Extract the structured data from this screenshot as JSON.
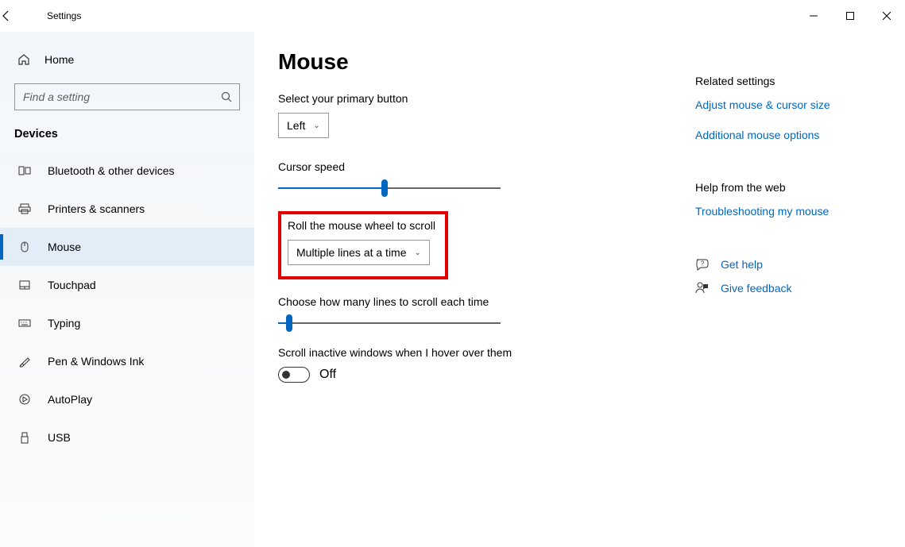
{
  "window": {
    "title": "Settings"
  },
  "sidebar": {
    "home": "Home",
    "search_placeholder": "Find a setting",
    "section_label": "Devices",
    "items": [
      {
        "label": "Bluetooth & other devices"
      },
      {
        "label": "Printers & scanners"
      },
      {
        "label": "Mouse"
      },
      {
        "label": "Touchpad"
      },
      {
        "label": "Typing"
      },
      {
        "label": "Pen & Windows Ink"
      },
      {
        "label": "AutoPlay"
      },
      {
        "label": "USB"
      }
    ]
  },
  "page": {
    "title": "Mouse",
    "primary_button_label": "Select your primary button",
    "primary_button_value": "Left",
    "cursor_speed_label": "Cursor speed",
    "cursor_speed_percent": 48,
    "scroll_mode_label": "Roll the mouse wheel to scroll",
    "scroll_mode_value": "Multiple lines at a time",
    "lines_label": "Choose how many lines to scroll each time",
    "lines_percent": 5,
    "inactive_label": "Scroll inactive windows when I hover over them",
    "inactive_state_text": "Off"
  },
  "right": {
    "related_head": "Related settings",
    "link_adjust": "Adjust mouse & cursor size",
    "link_additional": "Additional mouse options",
    "help_head": "Help from the web",
    "link_trouble": "Troubleshooting my mouse",
    "get_help": "Get help",
    "give_feedback": "Give feedback"
  }
}
